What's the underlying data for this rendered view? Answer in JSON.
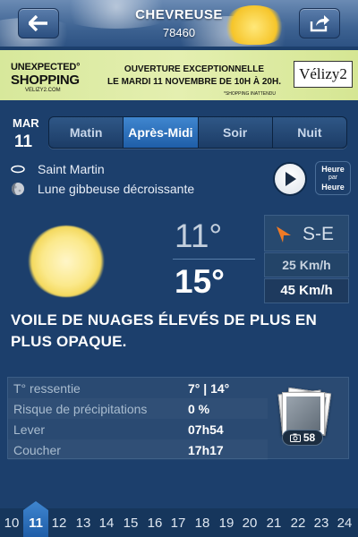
{
  "header": {
    "city": "CHEVREUSE",
    "zip": "78460",
    "back_icon": "arrow-left-icon",
    "share_icon": "share-icon"
  },
  "ad": {
    "brand_line1": "UNEXPECTED°",
    "brand_line2": "SHOPPING",
    "brand_site": "VELIZY2.COM",
    "message_line1": "OUVERTURE EXCEPTIONNELLE",
    "message_line2": "LE MARDI 11 NOVEMBRE DE 10H À 20H.",
    "footnote": "*SHOPPING INATTENDU",
    "logo": "Vélizy2"
  },
  "date": {
    "day_name": "MAR",
    "day_number": "11"
  },
  "tabs": [
    {
      "label": "Matin",
      "active": false
    },
    {
      "label": "Après-Midi",
      "active": true
    },
    {
      "label": "Soir",
      "active": false
    },
    {
      "label": "Nuit",
      "active": false
    }
  ],
  "info": {
    "saint": "Saint Martin",
    "moon": "Lune gibbeuse décroissante"
  },
  "controls": {
    "hour_by_hour_top": "Heure",
    "hour_by_hour_mid": "par",
    "hour_by_hour_bot": "Heure"
  },
  "weather": {
    "temp_min": "11°",
    "temp_max": "15°",
    "wind_direction": "S-E",
    "wind_speed": "25 Km/h",
    "wind_gust": "45 Km/h",
    "description": "VOILE DE NUAGES ÉLEVÉS DE PLUS EN PLUS OPAQUE."
  },
  "details": [
    {
      "label": "T° ressentie",
      "value": "7° | 14°"
    },
    {
      "label": "Risque de précipitations",
      "value": "0 %"
    },
    {
      "label": "Lever",
      "value": "07h54"
    },
    {
      "label": "Coucher",
      "value": "17h17"
    }
  ],
  "photos": {
    "count": "58"
  },
  "day_strip": {
    "days": [
      "10",
      "11",
      "12",
      "13",
      "14",
      "15",
      "16",
      "17",
      "18",
      "19",
      "20",
      "21",
      "22",
      "23",
      "24"
    ],
    "selected": "11"
  },
  "colors": {
    "background": "#1c3f6c",
    "accent": "#2f78c4",
    "wind_arrow": "#f07a25"
  }
}
